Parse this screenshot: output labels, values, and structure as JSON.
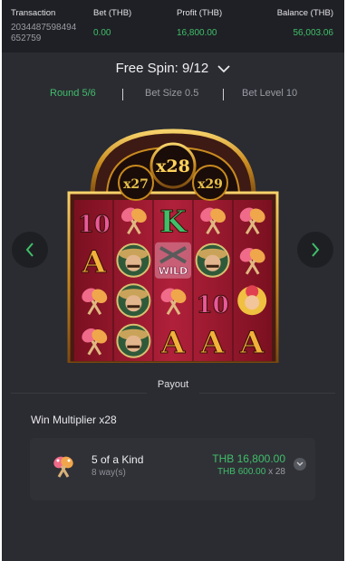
{
  "header": {
    "transaction_label": "Transaction",
    "transaction_value_line1": "2034487598494",
    "transaction_value_line2": "652759",
    "bet_label": "Bet (THB)",
    "bet_value": "0.00",
    "profit_label": "Profit (THB)",
    "profit_value": "16,800.00",
    "balance_label": "Balance (THB)",
    "balance_value": "56,003.06"
  },
  "spin": {
    "title": "Free Spin: 9/12",
    "round": "Round 5/6",
    "bet_size": "Bet Size 0.5",
    "bet_level": "Bet Level 10"
  },
  "game": {
    "multiplier_main": "x28",
    "multiplier_left": "x27",
    "multiplier_right": "x29",
    "wild_label": "WILD",
    "symbols": [
      [
        "10",
        "maracas",
        "K",
        "maracas",
        "maracas"
      ],
      [
        "A",
        "bandit",
        "wild",
        "bandit",
        "maracas"
      ],
      [
        "maracas",
        "bandit",
        "maracas",
        "10",
        "lady"
      ],
      [
        "maracas",
        "bandit",
        "A",
        "A",
        "A"
      ]
    ]
  },
  "payout": {
    "section_label": "Payout",
    "win_multiplier": "Win Multiplier x28",
    "items": [
      {
        "icon": "maracas-icon",
        "title": "5 of a Kind",
        "ways": "8 way(s)",
        "amount": "THB 16,800.00",
        "sub_amount": "THB 600.00",
        "sub_mult": " x 28"
      }
    ]
  },
  "colors": {
    "background": "#2b2c32",
    "header_bg": "#1f2025",
    "accent_green": "#3fbf6a",
    "card_bg": "#303137"
  }
}
